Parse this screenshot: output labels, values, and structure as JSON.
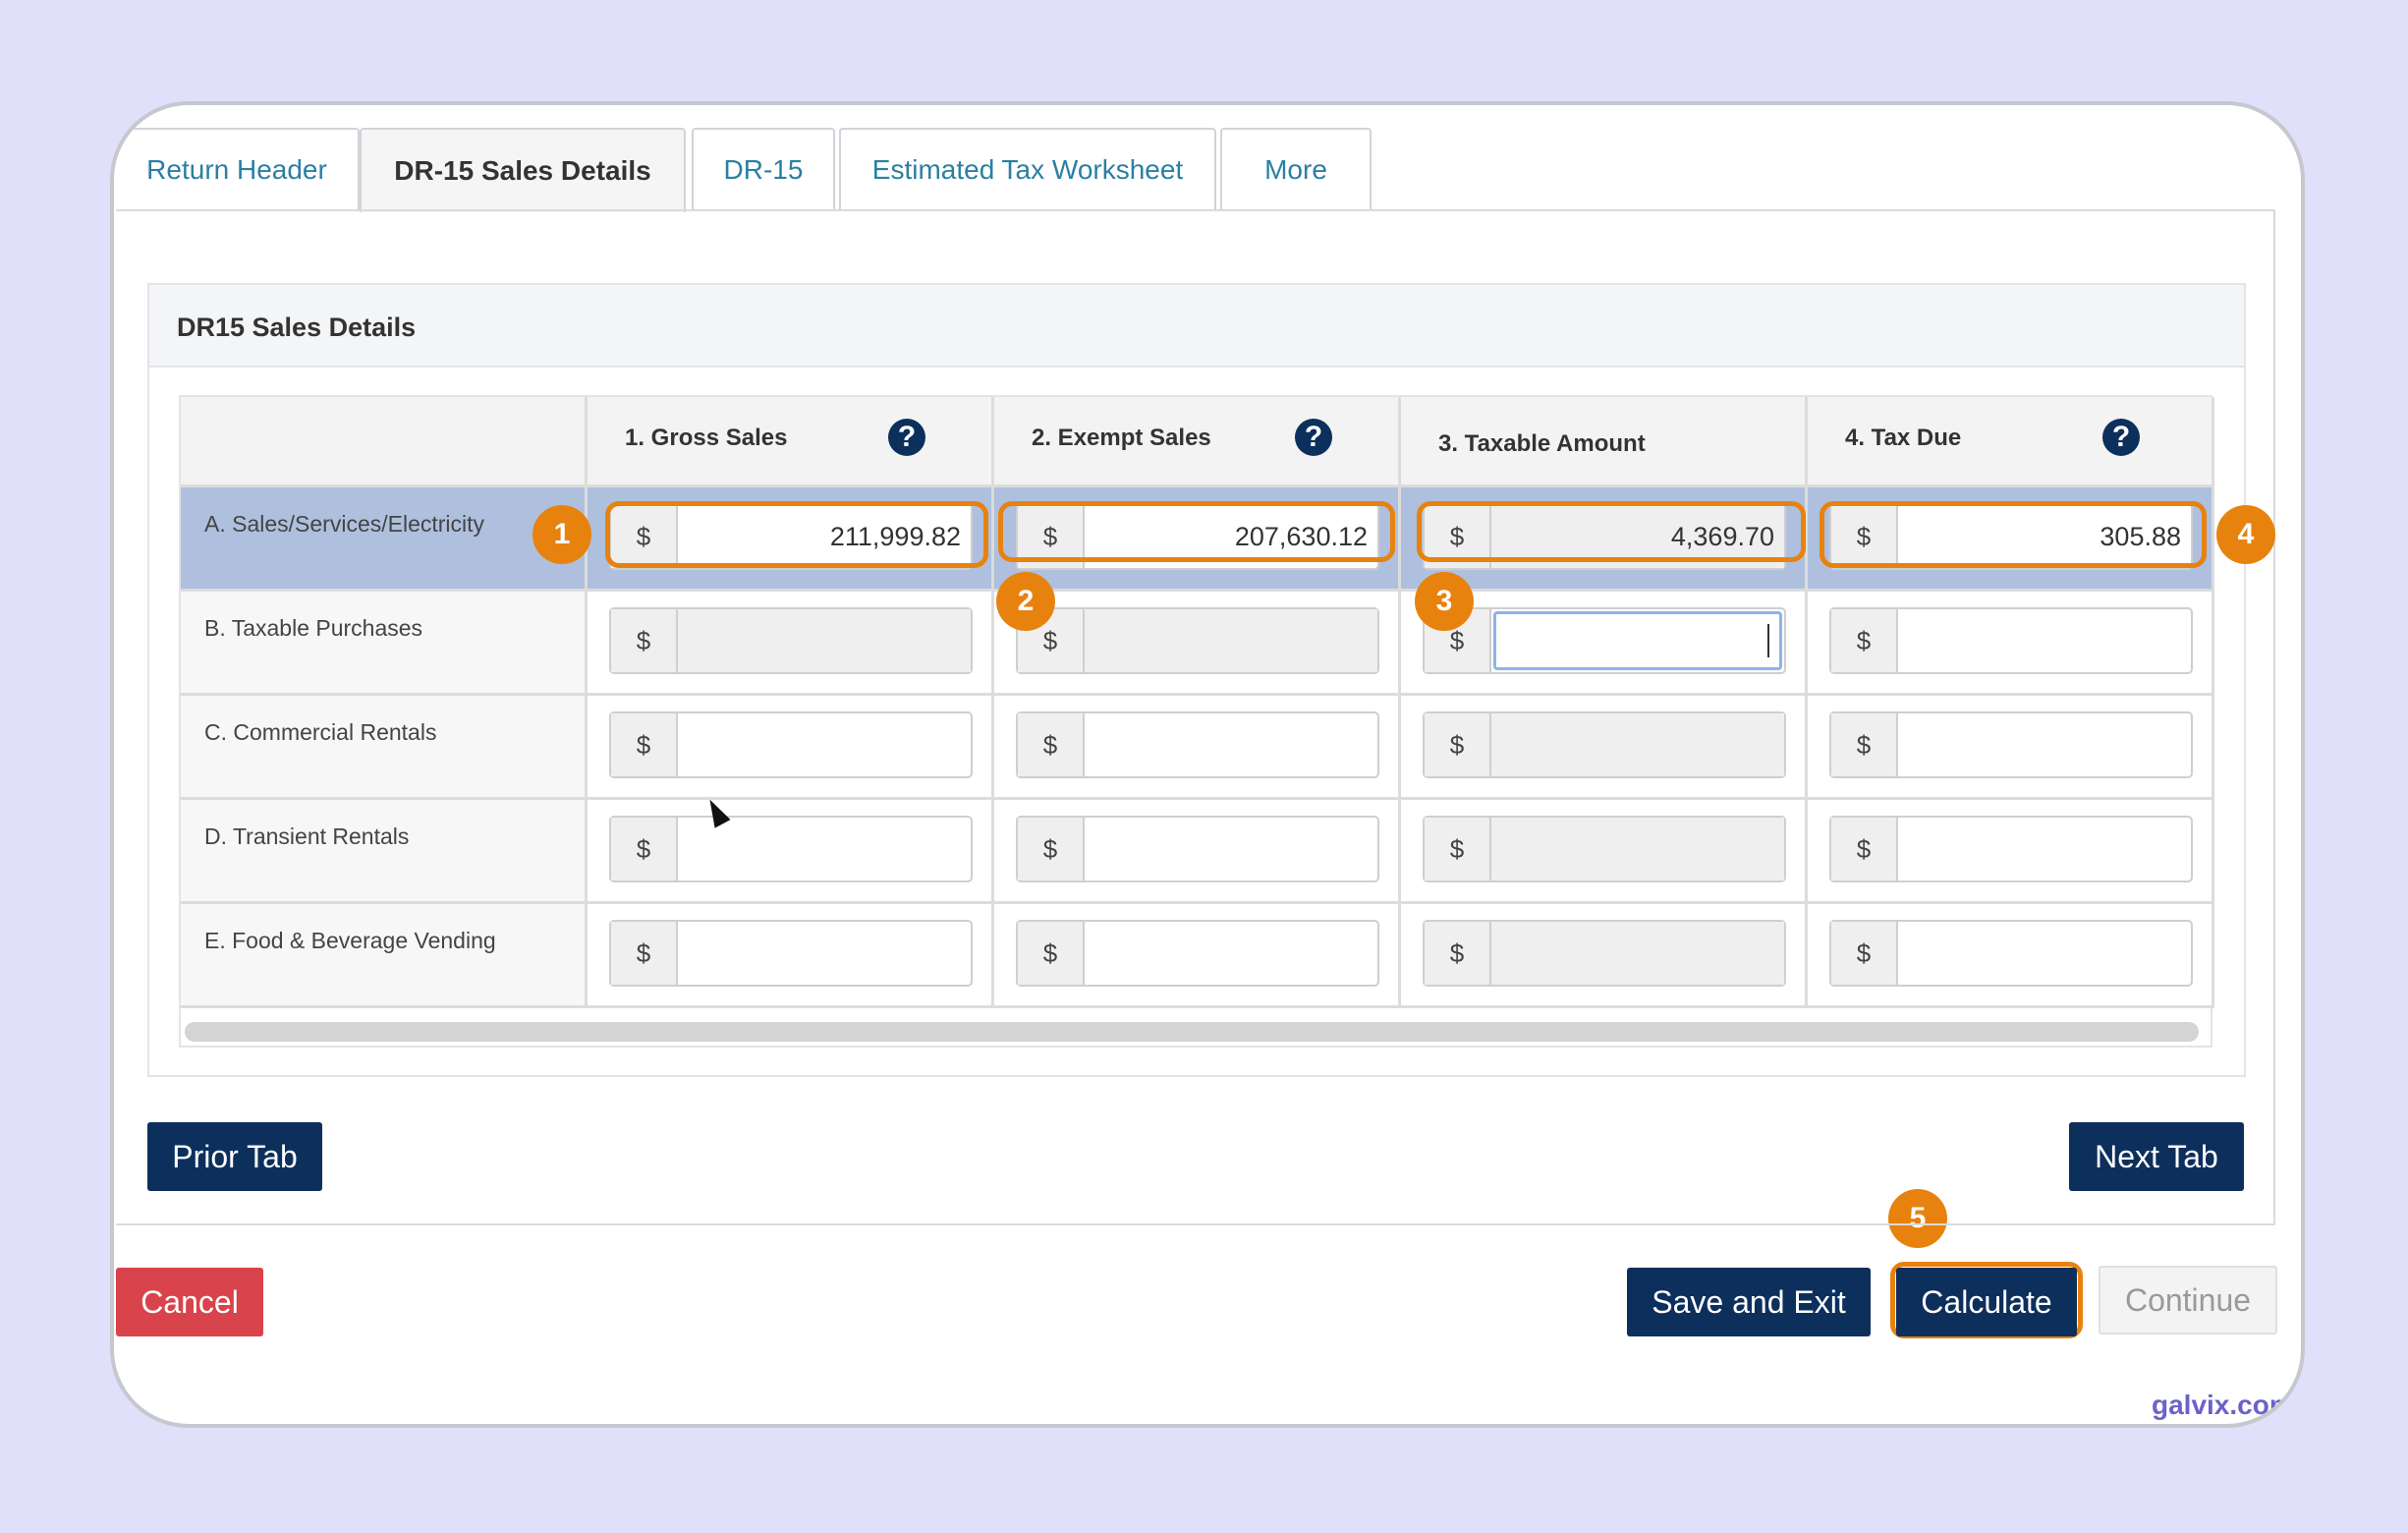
{
  "tabs": [
    "Return Header",
    "DR-15 Sales Details",
    "DR-15",
    "Estimated Tax Worksheet",
    "More"
  ],
  "panel_title": "DR15 Sales Details",
  "columns": [
    "1. Gross Sales",
    "2. Exempt Sales",
    "3. Taxable Amount",
    "4. Tax Due"
  ],
  "help_icon": "?",
  "currency": "$",
  "rows": [
    {
      "label": "A. Sales/Services/Electricity",
      "values": [
        "211,999.82",
        "207,630.12",
        "4,369.70",
        "305.88"
      ]
    },
    {
      "label": "B. Taxable Purchases",
      "values": [
        "",
        "",
        "",
        ""
      ]
    },
    {
      "label": "C. Commercial Rentals",
      "values": [
        "",
        "",
        "",
        ""
      ]
    },
    {
      "label": "D. Transient Rentals",
      "values": [
        "",
        "",
        "",
        ""
      ]
    },
    {
      "label": "E. Food & Beverage Vending",
      "values": [
        "",
        "",
        "",
        ""
      ]
    }
  ],
  "badges": [
    "1",
    "2",
    "3",
    "4",
    "5"
  ],
  "buttons": {
    "prior_tab": "Prior Tab",
    "next_tab": "Next Tab",
    "cancel": "Cancel",
    "save_exit": "Save and Exit",
    "calculate": "Calculate",
    "continue": "Continue"
  },
  "watermark": "galvix.com",
  "colors": {
    "accent": "#e8820f",
    "navy": "#0d2f5c",
    "cancel": "#d9434b",
    "selected_row": "#aec0de"
  }
}
